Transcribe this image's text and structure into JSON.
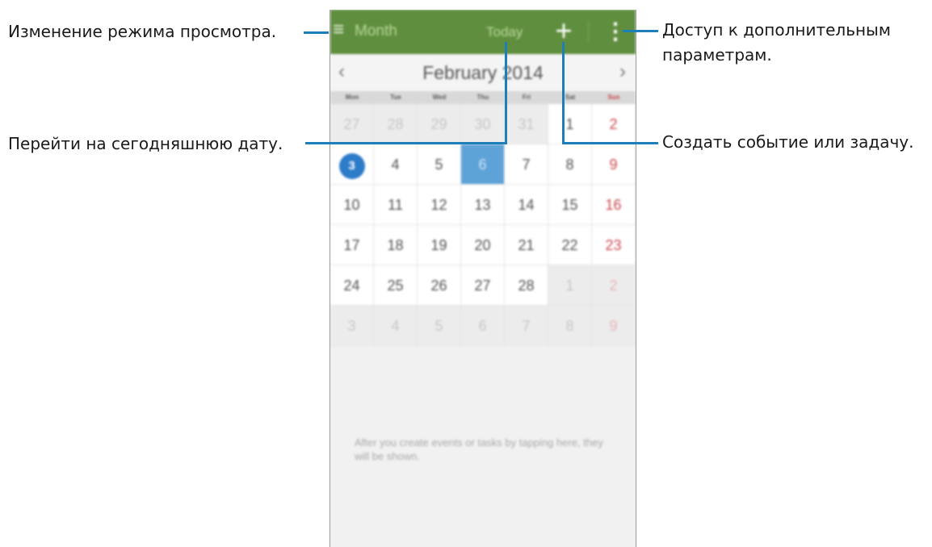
{
  "callouts": {
    "view_mode": "Изменение режима просмотра.",
    "more_options_1": "Доступ к дополнительным",
    "more_options_2": "параметрам.",
    "go_today": "Перейти на сегодняшнюю дату.",
    "create_event": "Создать событие или задачу."
  },
  "actionbar": {
    "menu_icon": "≡",
    "view_title": "Month",
    "today_label": "Today",
    "add_icon": "+",
    "more_icon": "⋮"
  },
  "calendar": {
    "prev_icon": "‹",
    "next_icon": "›",
    "month_label": "February 2014",
    "weekdays": [
      "Mon",
      "Tue",
      "Wed",
      "Thu",
      "Fri",
      "Sat",
      "Sun"
    ],
    "weeks": [
      [
        "27",
        "28",
        "29",
        "30",
        "31",
        "1",
        "2"
      ],
      [
        "3",
        "4",
        "5",
        "6",
        "7",
        "8",
        "9"
      ],
      [
        "10",
        "11",
        "12",
        "13",
        "14",
        "15",
        "16"
      ],
      [
        "17",
        "18",
        "19",
        "20",
        "21",
        "22",
        "23"
      ],
      [
        "24",
        "25",
        "26",
        "27",
        "28",
        "1",
        "2"
      ],
      [
        "3",
        "4",
        "5",
        "6",
        "7",
        "8",
        "9"
      ]
    ],
    "today_day": "3",
    "selected_day": "6",
    "empty_message": "After you create events or tasks by tapping here, they will be shown."
  },
  "colors": {
    "actionbar": "#5f8f3e",
    "today_circle": "#2d7cc9",
    "selected_cell": "#5ea3d8",
    "sunday": "#c9464c",
    "callout_line": "#1e7fb8"
  }
}
